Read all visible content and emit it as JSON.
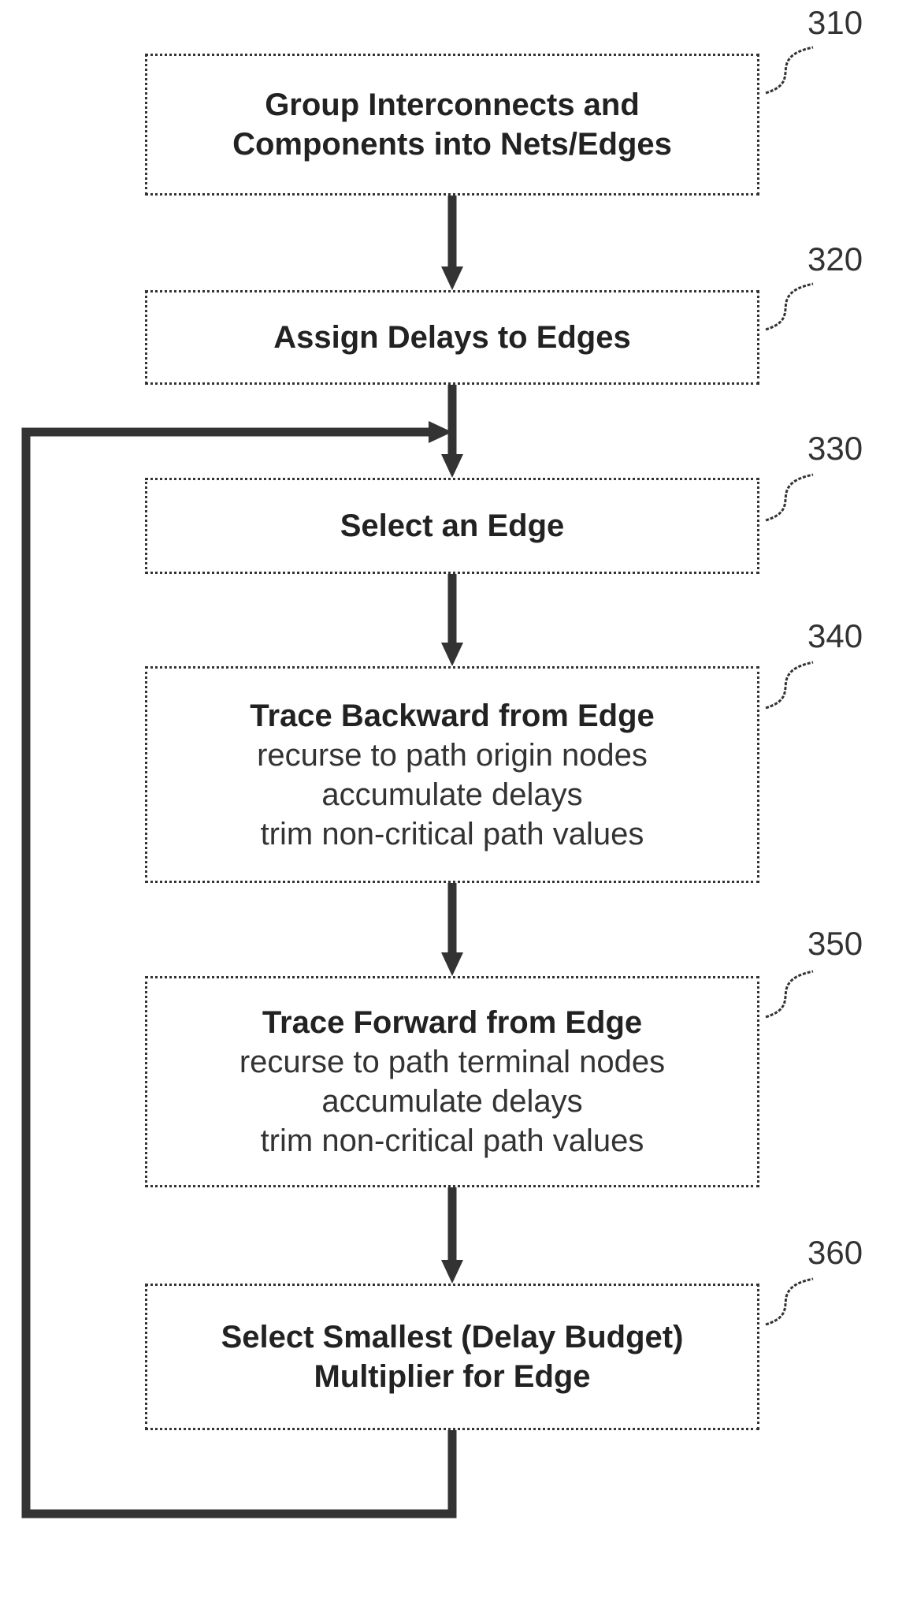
{
  "figure": {
    "steps": [
      {
        "ref": "310",
        "lines": [
          {
            "text": "Group Interconnects and",
            "style": "title"
          },
          {
            "text": "Components into Nets/Edges",
            "style": "title"
          }
        ]
      },
      {
        "ref": "320",
        "lines": [
          {
            "text": "Assign Delays to Edges",
            "style": "title"
          }
        ]
      },
      {
        "ref": "330",
        "lines": [
          {
            "text": "Select an Edge",
            "style": "title"
          }
        ]
      },
      {
        "ref": "340",
        "lines": [
          {
            "text": "Trace Backward from Edge",
            "style": "title"
          },
          {
            "text": "recurse to path origin nodes",
            "style": "sub"
          },
          {
            "text": "accumulate delays",
            "style": "sub"
          },
          {
            "text": "trim non-critical path values",
            "style": "sub"
          }
        ]
      },
      {
        "ref": "350",
        "lines": [
          {
            "text": "Trace Forward from Edge",
            "style": "title"
          },
          {
            "text": "recurse to path terminal nodes",
            "style": "sub"
          },
          {
            "text": "accumulate delays",
            "style": "sub"
          },
          {
            "text": "trim non-critical path values",
            "style": "sub"
          }
        ]
      },
      {
        "ref": "360",
        "lines": [
          {
            "text": "Select Smallest (Delay Budget)",
            "style": "title"
          },
          {
            "text": "Multiplier for Edge",
            "style": "title"
          }
        ]
      }
    ],
    "flow": [
      {
        "from": "310",
        "to": "320"
      },
      {
        "from": "320",
        "to": "330"
      },
      {
        "from": "330",
        "to": "340"
      },
      {
        "from": "340",
        "to": "350"
      },
      {
        "from": "350",
        "to": "360"
      },
      {
        "from": "360",
        "to": "330",
        "type": "loop-back"
      }
    ],
    "colors": {
      "line": "#333333",
      "box_border": "#333333",
      "background": "#ffffff"
    }
  }
}
